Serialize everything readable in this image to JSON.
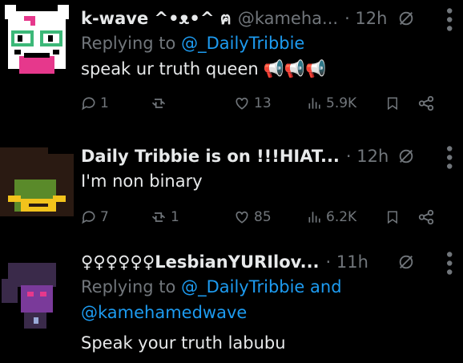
{
  "posts": [
    {
      "author": "k-wave ^•ᴥ•^ ฅ",
      "handle": "@kameha...",
      "time": "· 12h",
      "replying_prefix": "Replying to",
      "replying_to": "@_DailyTribbie",
      "text": "speak ur truth queen",
      "emoji": "📢📢📢",
      "replies": "1",
      "reposts": "",
      "likes": "13",
      "views": "5.9K",
      "avatar_colors": {
        "bg": "#ffffff",
        "accent": "#e6388c",
        "eye": "#3cb878"
      }
    },
    {
      "author": "Daily Tribbie is on !!!HIAT...",
      "handle": "",
      "time": "· 12h",
      "text": "I'm non binary",
      "replies": "7",
      "reposts": "1",
      "likes": "85",
      "views": "6.2K",
      "avatar_colors": {
        "bg": "#2a1a12",
        "accent": "#5a8a2a",
        "eye": "#f2c31c"
      }
    },
    {
      "author": "♀♀♀♀♀♀LesbianYURIlov...",
      "handle": "",
      "time": "· 11h",
      "replying_prefix": "Replying to",
      "replying_to": "@_DailyTribbie and",
      "replying_to_2": "@kamehamedwave",
      "text": "Speak your truth labubu",
      "avatar_colors": {
        "bg": "#3a2a4a",
        "accent": "#7a3a9a",
        "eye": "#9aaad8"
      }
    }
  ],
  "icons": [
    "grok-icon",
    "more-icon",
    "reply-icon",
    "repost-icon",
    "like-icon",
    "views-icon",
    "bookmark-icon",
    "share-icon"
  ],
  "colors": {
    "background": "#000000",
    "text": "#e7e9ea",
    "muted": "#71767b",
    "link": "#1d9bf0"
  }
}
